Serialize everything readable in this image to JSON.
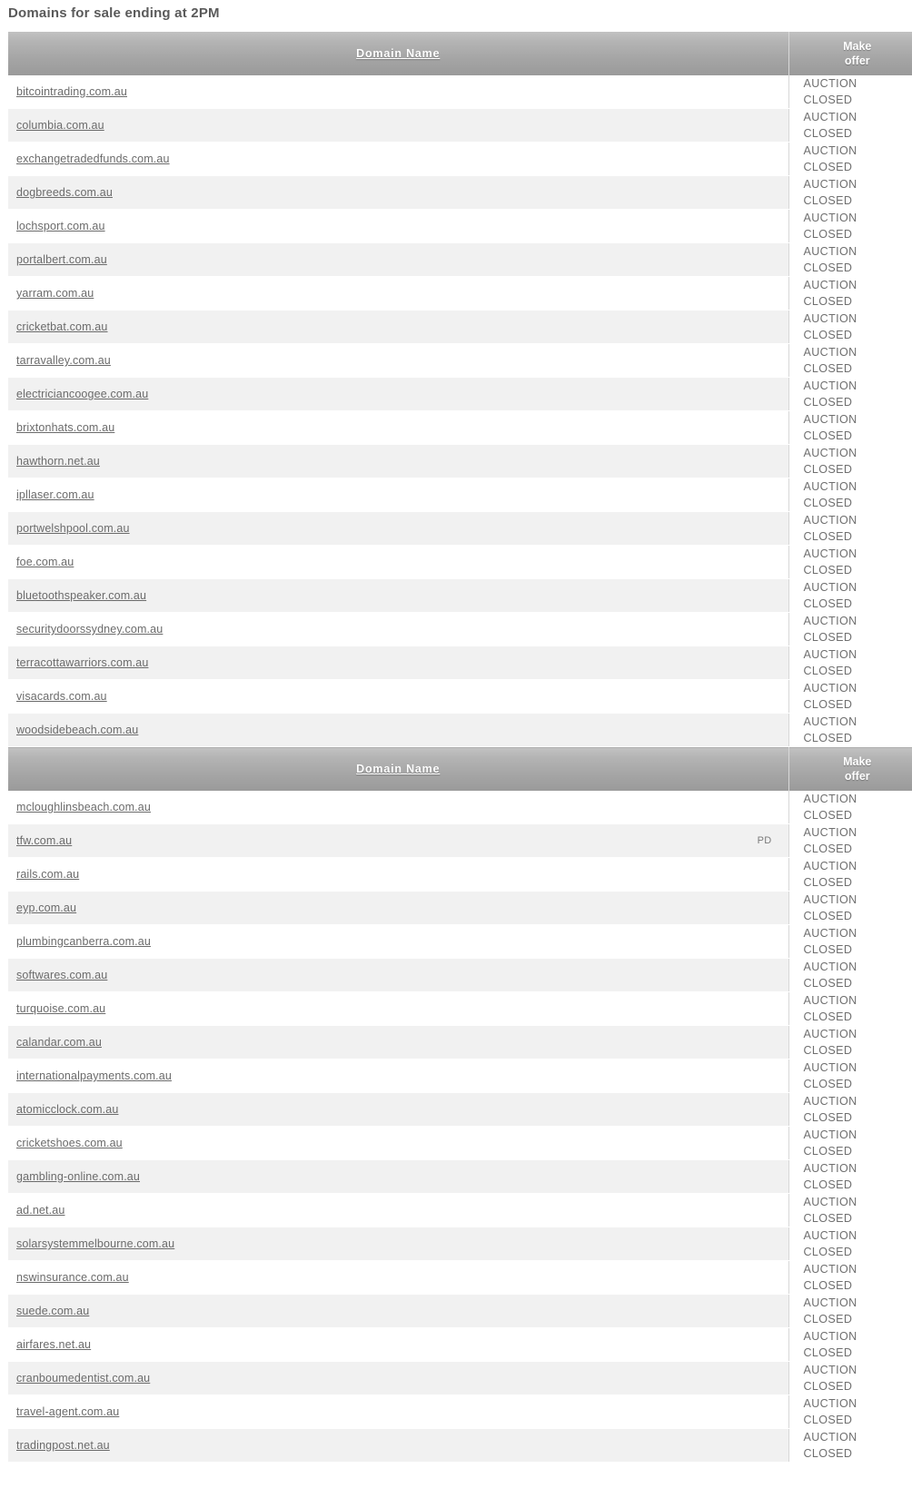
{
  "page": {
    "title": "Domains for sale ending at 2PM"
  },
  "table": {
    "columns": {
      "domain_name": "Domain Name",
      "make_offer_line1": "Make",
      "make_offer_line2": "offer"
    },
    "status": {
      "line1": "AUCTION",
      "line2": "CLOSED"
    },
    "flags": {
      "pd": "PD"
    },
    "sections": [
      {
        "header": {
          "domain_name": "Domain Name",
          "make_offer_line1": "Make",
          "make_offer_line2": "offer"
        },
        "rows": [
          {
            "domain": "bitcointrading.com.au",
            "flag": "",
            "status1": "AUCTION",
            "status2": "CLOSED"
          },
          {
            "domain": "columbia.com.au",
            "flag": "",
            "status1": "AUCTION",
            "status2": "CLOSED"
          },
          {
            "domain": "exchangetradedfunds.com.au",
            "flag": "",
            "status1": "AUCTION",
            "status2": "CLOSED"
          },
          {
            "domain": "dogbreeds.com.au",
            "flag": "",
            "status1": "AUCTION",
            "status2": "CLOSED"
          },
          {
            "domain": "lochsport.com.au",
            "flag": "",
            "status1": "AUCTION",
            "status2": "CLOSED"
          },
          {
            "domain": "portalbert.com.au",
            "flag": "",
            "status1": "AUCTION",
            "status2": "CLOSED"
          },
          {
            "domain": "yarram.com.au",
            "flag": "",
            "status1": "AUCTION",
            "status2": "CLOSED"
          },
          {
            "domain": "cricketbat.com.au",
            "flag": "",
            "status1": "AUCTION",
            "status2": "CLOSED"
          },
          {
            "domain": "tarravalley.com.au",
            "flag": "",
            "status1": "AUCTION",
            "status2": "CLOSED"
          },
          {
            "domain": "electriciancoogee.com.au",
            "flag": "",
            "status1": "AUCTION",
            "status2": "CLOSED"
          },
          {
            "domain": "brixtonhats.com.au",
            "flag": "",
            "status1": "AUCTION",
            "status2": "CLOSED"
          },
          {
            "domain": "hawthorn.net.au",
            "flag": "",
            "status1": "AUCTION",
            "status2": "CLOSED"
          },
          {
            "domain": "ipllaser.com.au",
            "flag": "",
            "status1": "AUCTION",
            "status2": "CLOSED"
          },
          {
            "domain": "portwelshpool.com.au",
            "flag": "",
            "status1": "AUCTION",
            "status2": "CLOSED"
          },
          {
            "domain": "foe.com.au",
            "flag": "",
            "status1": "AUCTION",
            "status2": "CLOSED"
          },
          {
            "domain": "bluetoothspeaker.com.au",
            "flag": "",
            "status1": "AUCTION",
            "status2": "CLOSED"
          },
          {
            "domain": "securitydoorssydney.com.au",
            "flag": "",
            "status1": "AUCTION",
            "status2": "CLOSED"
          },
          {
            "domain": "terracottawarriors.com.au",
            "flag": "",
            "status1": "AUCTION",
            "status2": "CLOSED"
          },
          {
            "domain": "visacards.com.au",
            "flag": "",
            "status1": "AUCTION",
            "status2": "CLOSED"
          },
          {
            "domain": "woodsidebeach.com.au",
            "flag": "",
            "status1": "AUCTION",
            "status2": "CLOSED"
          }
        ]
      },
      {
        "header": {
          "domain_name": "Domain Name",
          "make_offer_line1": "Make",
          "make_offer_line2": "offer"
        },
        "rows": [
          {
            "domain": "mcloughlinsbeach.com.au",
            "flag": "",
            "status1": "AUCTION",
            "status2": "CLOSED"
          },
          {
            "domain": "tfw.com.au",
            "flag": "PD",
            "status1": "AUCTION",
            "status2": "CLOSED"
          },
          {
            "domain": "rails.com.au",
            "flag": "",
            "status1": "AUCTION",
            "status2": "CLOSED"
          },
          {
            "domain": "eyp.com.au",
            "flag": "",
            "status1": "AUCTION",
            "status2": "CLOSED"
          },
          {
            "domain": "plumbingcanberra.com.au",
            "flag": "",
            "status1": "AUCTION",
            "status2": "CLOSED"
          },
          {
            "domain": "softwares.com.au",
            "flag": "",
            "status1": "AUCTION",
            "status2": "CLOSED"
          },
          {
            "domain": "turquoise.com.au",
            "flag": "",
            "status1": "AUCTION",
            "status2": "CLOSED"
          },
          {
            "domain": "calandar.com.au",
            "flag": "",
            "status1": "AUCTION",
            "status2": "CLOSED"
          },
          {
            "domain": "internationalpayments.com.au",
            "flag": "",
            "status1": "AUCTION",
            "status2": "CLOSED"
          },
          {
            "domain": "atomicclock.com.au",
            "flag": "",
            "status1": "AUCTION",
            "status2": "CLOSED"
          },
          {
            "domain": "cricketshoes.com.au",
            "flag": "",
            "status1": "AUCTION",
            "status2": "CLOSED"
          },
          {
            "domain": "gambling-online.com.au",
            "flag": "",
            "status1": "AUCTION",
            "status2": "CLOSED"
          },
          {
            "domain": "ad.net.au",
            "flag": "",
            "status1": "AUCTION",
            "status2": "CLOSED"
          },
          {
            "domain": "solarsystemmelbourne.com.au",
            "flag": "",
            "status1": "AUCTION",
            "status2": "CLOSED"
          },
          {
            "domain": "nswinsurance.com.au",
            "flag": "",
            "status1": "AUCTION",
            "status2": "CLOSED"
          },
          {
            "domain": "suede.com.au",
            "flag": "",
            "status1": "AUCTION",
            "status2": "CLOSED"
          },
          {
            "domain": "airfares.net.au",
            "flag": "",
            "status1": "AUCTION",
            "status2": "CLOSED"
          },
          {
            "domain": "cranboumedentist.com.au",
            "flag": "",
            "status1": "AUCTION",
            "status2": "CLOSED"
          },
          {
            "domain": "travel-agent.com.au",
            "flag": "",
            "status1": "AUCTION",
            "status2": "CLOSED"
          },
          {
            "domain": "tradingpost.net.au",
            "flag": "",
            "status1": "AUCTION",
            "status2": "CLOSED"
          }
        ]
      }
    ]
  },
  "colors": {
    "header_gradient_top": "#c2c2c2",
    "header_gradient_bottom": "#9a9a9a",
    "row_alt_background": "#f1f1f1",
    "link_text": "#6b6b6b",
    "title_text": "#5a5a5a"
  }
}
